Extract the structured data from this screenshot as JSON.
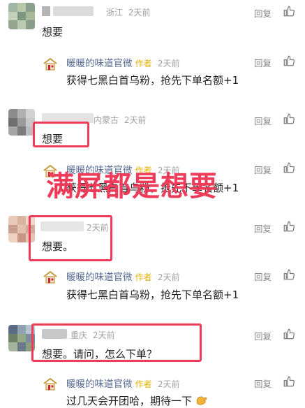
{
  "comments": [
    {
      "user_location": "浙江",
      "user_time": "2天前",
      "text": "想要",
      "reply_label": "回复",
      "reply": {
        "author_name": "暖暖的味道官微",
        "author_tag": "作者",
        "time": "2天前",
        "text": "获得七黑白首乌粉，抢先下单名额+1",
        "reply_label": "回复"
      }
    },
    {
      "user_location": "内蒙古",
      "user_time": "2天前",
      "text": "想要",
      "reply_label": "回复",
      "reply": {
        "author_name": "暖暖的味道官微",
        "author_tag": "作者",
        "time": "2天前",
        "text": "获得七黑白首乌粉，抢先下单名额+1",
        "reply_label": "回复"
      }
    },
    {
      "user_time": "2天前",
      "text": "想要。",
      "reply_label": "回复",
      "reply": {
        "author_name": "暖暖的味道官微",
        "author_tag": "作者",
        "time": "2天前",
        "text": "获得七黑白首乌粉，抢先下单名额+1",
        "reply_label": "回复"
      }
    },
    {
      "user_location": "重庆",
      "user_time": "2天前",
      "text": "想要。请问，怎么下单？",
      "reply_label": "回复",
      "reply": {
        "author_name": "暖暖的味道官微",
        "author_tag": "作者",
        "time": "2天前",
        "text": "过几天会开团哈，期待一下",
        "reply_label": "回复"
      }
    }
  ],
  "overlay_caption": "满屏都是想要",
  "colors": {
    "highlight": "#ee3b5a",
    "author_tag": "#e6b100",
    "nickname": "#576b95"
  },
  "icons": [
    "like-thumb-icon",
    "brand-logo-icon",
    "emoji-hand-icon"
  ]
}
